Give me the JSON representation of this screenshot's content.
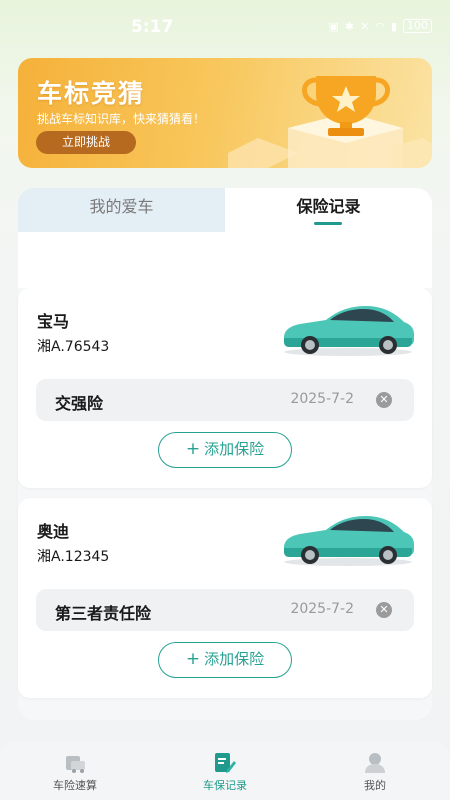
{
  "status_bar": {
    "time": "5:17",
    "battery": "100"
  },
  "banner": {
    "title": "车标竞猜",
    "subtitle": "挑战车标知识库，快来猜猜看！",
    "button_label": "立即挑战"
  },
  "tabs": [
    {
      "label": "我的爱车",
      "active": false
    },
    {
      "label": "保险记录",
      "active": true
    }
  ],
  "cars": [
    {
      "name": "宝马",
      "plate": "湘A.76543",
      "insurance": {
        "name": "交强险",
        "date": "2025-7-2"
      },
      "add_label": "添加保险"
    },
    {
      "name": "奥迪",
      "plate": "湘A.12345",
      "insurance": {
        "name": "第三者责任险",
        "date": "2025-7-2"
      },
      "add_label": "添加保险"
    }
  ],
  "bottom_nav": [
    {
      "label": "车险速算",
      "icon": "car-icon",
      "active": false
    },
    {
      "label": "车保记录",
      "icon": "edit-record-icon",
      "active": true
    },
    {
      "label": "我的",
      "icon": "user-icon",
      "active": false
    }
  ],
  "colors": {
    "accent": "#1f9a8c",
    "banner": "#f5b13a",
    "button_brown": "#b56a20"
  }
}
